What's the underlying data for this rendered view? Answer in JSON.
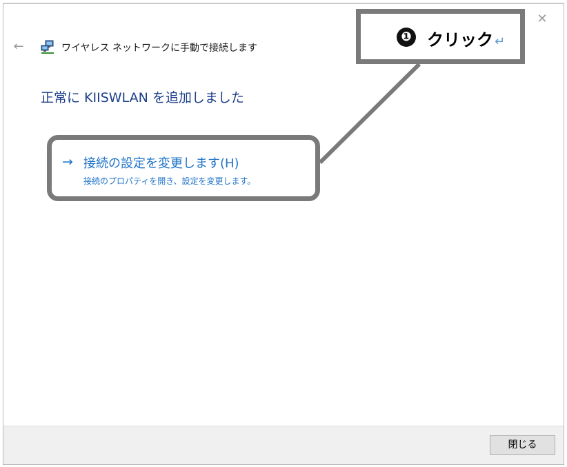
{
  "window": {
    "title": "ワイヤレス ネットワークに手動で接続します",
    "back_icon": "←",
    "close_icon": "✕"
  },
  "main": {
    "heading": "正常に KIISWLAN を追加しました",
    "link": {
      "arrow": "→",
      "title": "接続の設定を変更します(H)",
      "description": "接続のプロパティを開き、設定を変更します。"
    }
  },
  "annotation": {
    "step": "❶",
    "label": "クリック",
    "return_mark": "↵"
  },
  "footer": {
    "close_label": "閉じる"
  },
  "colors": {
    "heading": "#1e3f8a",
    "link": "#1e73c8",
    "callout_border": "#7a7a7a"
  }
}
